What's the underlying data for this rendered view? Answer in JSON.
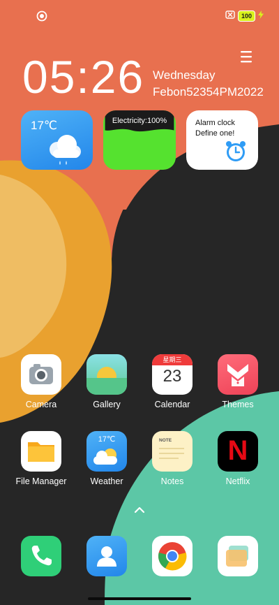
{
  "status_bar": {
    "battery_level": "100",
    "left_icon": "app-notification-icon",
    "icons": [
      "sim-off-icon",
      "battery-icon",
      "charging-icon"
    ]
  },
  "clock": {
    "time": "05:26",
    "day": "Wednesday",
    "date": "Febon52354PM2022"
  },
  "widgets": {
    "weather": {
      "temperature": "17℃",
      "icon": "cloud-rain-icon"
    },
    "battery": {
      "label": "Electricity:100%"
    },
    "alarm": {
      "line1": "Alarm clock",
      "line2": "Define one!",
      "icon": "alarm-clock-icon"
    }
  },
  "apps": [
    {
      "label": "Camera",
      "icon": "camera-icon"
    },
    {
      "label": "Gallery",
      "icon": "gallery-icon"
    },
    {
      "label": "Calendar",
      "icon": "calendar-icon",
      "header": "星期三",
      "day": "23"
    },
    {
      "label": "Themes",
      "icon": "themes-icon"
    },
    {
      "label": "File Manager",
      "icon": "folder-icon"
    },
    {
      "label": "Weather",
      "icon": "weather-icon",
      "temperature": "17℃"
    },
    {
      "label": "Notes",
      "icon": "notes-icon",
      "header": "NOTE"
    },
    {
      "label": "Netflix",
      "icon": "netflix-icon",
      "glyph": "N"
    }
  ],
  "dock": [
    {
      "icon": "phone-icon"
    },
    {
      "icon": "contacts-icon"
    },
    {
      "icon": "chrome-icon"
    },
    {
      "icon": "cards-app-icon"
    }
  ],
  "colors": {
    "wallpaper_orange": "#e8704f",
    "wallpaper_teal": "#5cc7a6",
    "wallpaper_yellow": "#e9a12f",
    "wallpaper_dark": "#262626",
    "battery_green": "#55e22f"
  }
}
